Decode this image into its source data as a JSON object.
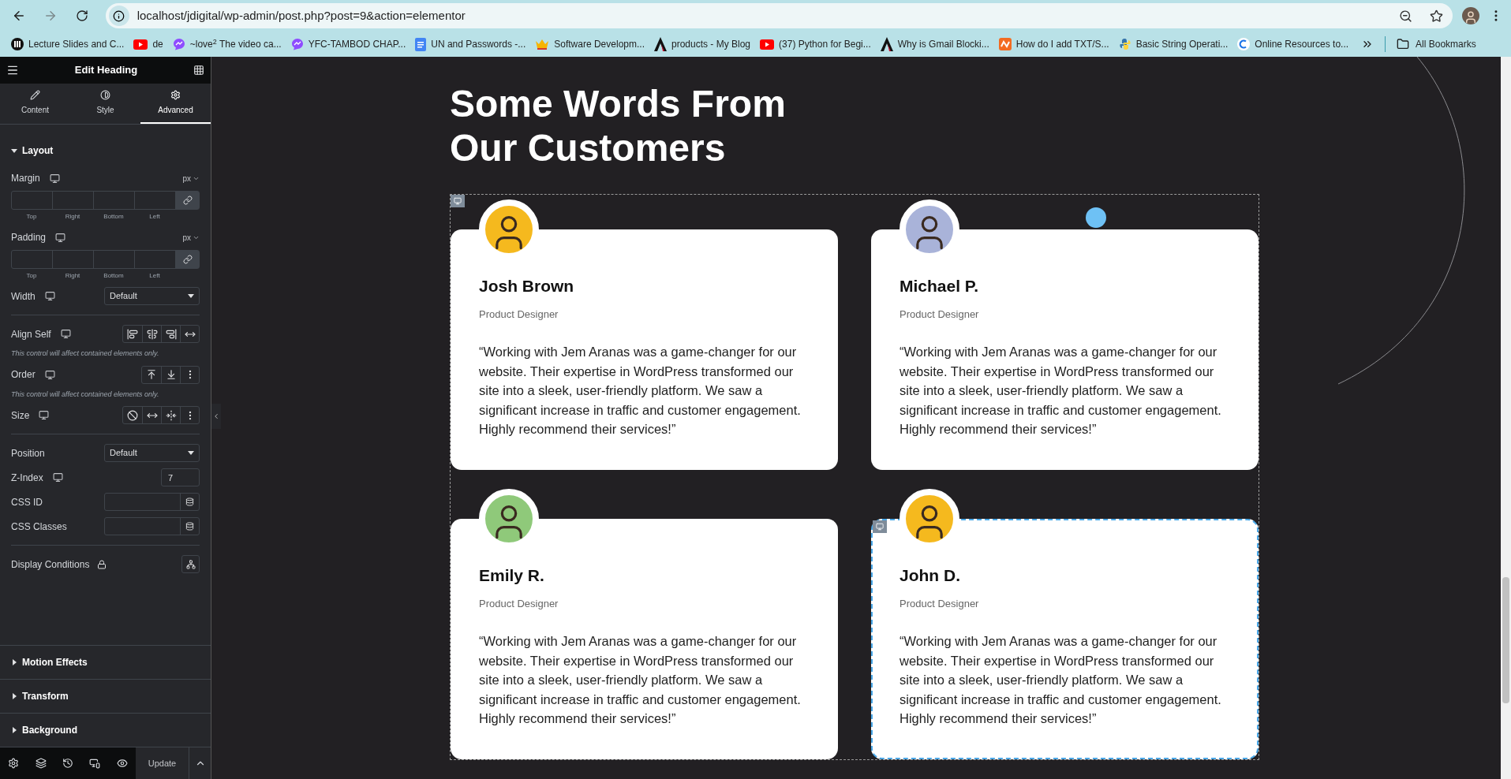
{
  "browser": {
    "url": "localhost/jdigital/wp-admin/post.php?post=9&action=elementor",
    "bookmarks": [
      "Lecture Slides and C...",
      "de",
      "~love$^{2}$ The video ca...",
      "YFC-TAMBOD CHAP...",
      "UN and Passwords -...",
      "Software Developm...",
      "products - My Blog",
      "(37) Python for Begi...",
      "Why is Gmail Blocki...",
      "How do I add TXT/S...",
      "Basic String Operati...",
      "Online Resources to..."
    ],
    "all_bookmarks": "All Bookmarks"
  },
  "sidebar": {
    "title": "Edit Heading",
    "tabs": [
      {
        "label": "Content",
        "selected": false
      },
      {
        "label": "Style",
        "selected": false
      },
      {
        "label": "Advanced",
        "selected": true
      }
    ],
    "section": {
      "title": "Layout",
      "expanded": true
    },
    "controls": [
      {
        "kind": "dimensions",
        "label": "Margin",
        "unit": "px",
        "parts": [
          "Top",
          "Right",
          "Bottom",
          "Left"
        ]
      },
      {
        "kind": "dimensions",
        "label": "Padding",
        "unit": "px",
        "parts": [
          "Top",
          "Right",
          "Bottom",
          "Left"
        ]
      },
      {
        "kind": "select",
        "label": "Width",
        "value": "Default",
        "responsive": true
      },
      {
        "kind": "divider"
      },
      {
        "kind": "align",
        "label": "Align Self",
        "note": "This control will affect contained elements only."
      },
      {
        "kind": "order",
        "label": "Order",
        "note": "This control will affect contained elements only."
      },
      {
        "kind": "size",
        "label": "Size"
      },
      {
        "kind": "divider"
      },
      {
        "kind": "select",
        "label": "Position",
        "value": "Default",
        "responsive": false
      },
      {
        "kind": "number",
        "label": "Z-Index",
        "value": "7"
      },
      {
        "kind": "dynamic",
        "label": "CSS ID"
      },
      {
        "kind": "dynamic",
        "label": "CSS Classes"
      },
      {
        "kind": "divider"
      },
      {
        "kind": "conditions",
        "label": "Display Conditions"
      }
    ],
    "collapsed_sections": [
      {
        "title": "Motion Effects",
        "expanded": false
      },
      {
        "title": "Transform",
        "expanded": false
      },
      {
        "title": "Background",
        "expanded": false
      }
    ],
    "update_button": "Update"
  },
  "page": {
    "heading": "Some Words From Our Customers",
    "testimonials": [
      {
        "name": "Josh Brown",
        "role": "Product Designer",
        "color": "#f5b91e",
        "quote": "“Working with Jem Aranas was a game-changer for our website. Their expertise in WordPress transformed our site into a sleek, user-friendly platform. We saw a significant increase in traffic and customer engagement. Highly recommend their services!”",
        "selected": false
      },
      {
        "name": "Michael P.",
        "role": "Product Designer",
        "color": "#a9b3d9",
        "quote": "“Working with Jem Aranas was a game-changer for our website. Their expertise in WordPress transformed our site into a sleek, user-friendly platform. We saw a significant increase in traffic and customer engagement. Highly recommend their services!”",
        "selected": false
      },
      {
        "name": "Emily R.",
        "role": "Product Designer",
        "color": "#8fc97a",
        "quote": "“Working with Jem Aranas was a game-changer for our website. Their expertise in WordPress transformed our site into a sleek, user-friendly platform. We saw a significant increase in traffic and customer engagement. Highly recommend their services!”",
        "selected": false
      },
      {
        "name": "John D.",
        "role": "Product Designer",
        "color": "#f5b91e",
        "quote": "“Working with Jem Aranas was a game-changer for our website. Their expertise in WordPress transformed our site into a sleek, user-friendly platform. We saw a significant increase in traffic and customer engagement. Highly recommend their services!”",
        "selected": true
      }
    ]
  }
}
